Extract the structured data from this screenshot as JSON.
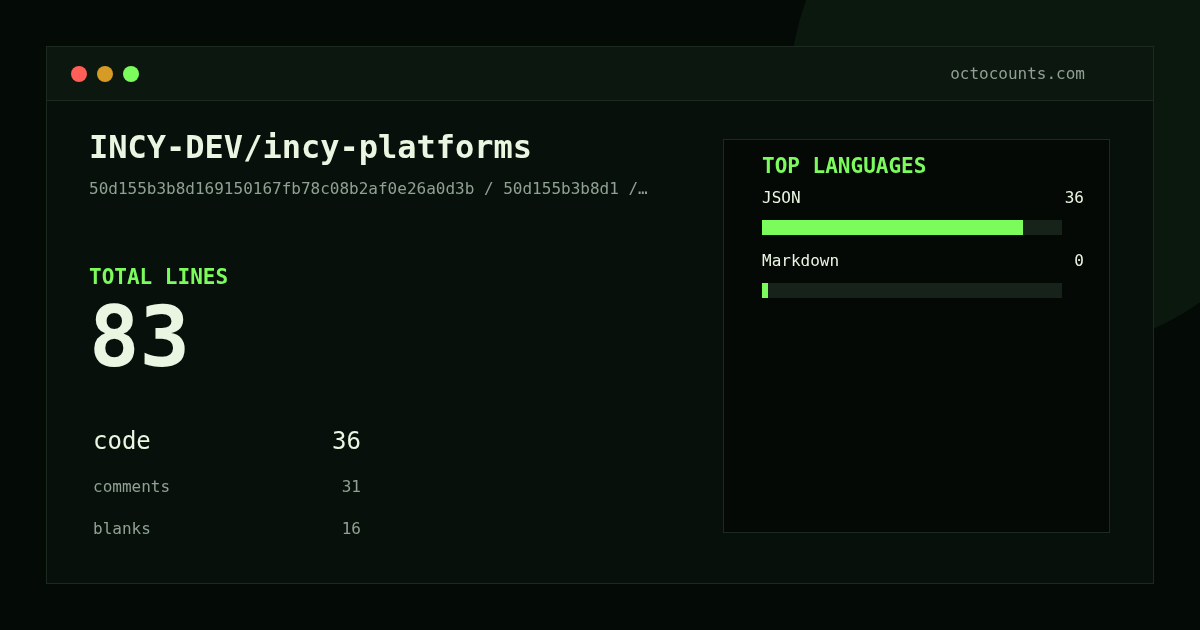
{
  "window": {
    "domain": "octocounts.com"
  },
  "repo": {
    "name": "INCY-DEV/incy-platforms",
    "path": "50d155b3b8d169150167fb78c08b2af0e26a0d3b / 50d155b3b8d1 /…"
  },
  "total": {
    "label": "TOTAL LINES",
    "value": "83"
  },
  "stats": [
    {
      "kind": "primary",
      "label": "code",
      "value": "36"
    },
    {
      "kind": "secondary",
      "label": "comments",
      "value": "31"
    },
    {
      "kind": "secondary",
      "label": "blanks",
      "value": "16"
    }
  ],
  "languages": {
    "title": "TOP LANGUAGES",
    "items": [
      {
        "name": "JSON",
        "count": "36",
        "level": 0.87
      },
      {
        "name": "Markdown",
        "count": "0",
        "level": 0.02
      }
    ]
  }
}
